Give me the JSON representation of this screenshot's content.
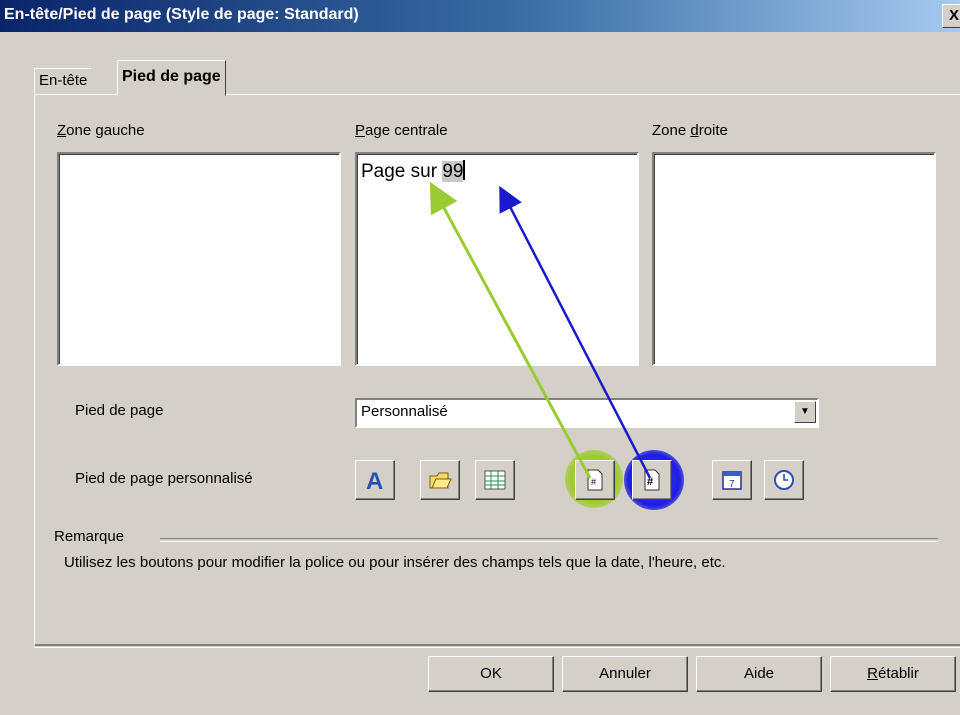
{
  "window": {
    "title": "En-tête/Pied de page (Style de page: Standard)",
    "close_label": "X"
  },
  "tabs": [
    {
      "label": "En-tête",
      "active": false
    },
    {
      "label": "Pied de page",
      "active": true
    }
  ],
  "zones": {
    "left": {
      "label_first": "Z",
      "label_rest": "one gauche",
      "content": ""
    },
    "center": {
      "label_first": "P",
      "label_rest": "age centrale",
      "content_prefix": "Page ",
      "field_page": " ",
      "content_mid": " sur ",
      "field_count": "99"
    },
    "right": {
      "label_pre": "Zone ",
      "label_first": "d",
      "label_rest": "roite",
      "content": ""
    }
  },
  "footer_select": {
    "label": "Pied de page",
    "value": "Personnalisé"
  },
  "custom_footer": {
    "label": "Pied de page personnalisé",
    "buttons": [
      "font-icon",
      "file-name-icon",
      "sheet-name-icon",
      "page-number-icon",
      "page-count-icon",
      "date-icon",
      "time-icon"
    ]
  },
  "remark": {
    "label": "Remarque",
    "text": "Utilisez les boutons pour modifier la police ou pour insérer des champs tels que la date, l'heure, etc."
  },
  "buttons": {
    "ok": "OK",
    "cancel": "Annuler",
    "help": "Aide",
    "reset_first": "R",
    "reset_rest": "établir"
  },
  "colors": {
    "title_start": "#0a246a",
    "title_end": "#a6caf0",
    "dialog_bg": "#d4d0c8",
    "green_arrow": "#99cc33",
    "blue_arrow": "#1a1acc"
  }
}
